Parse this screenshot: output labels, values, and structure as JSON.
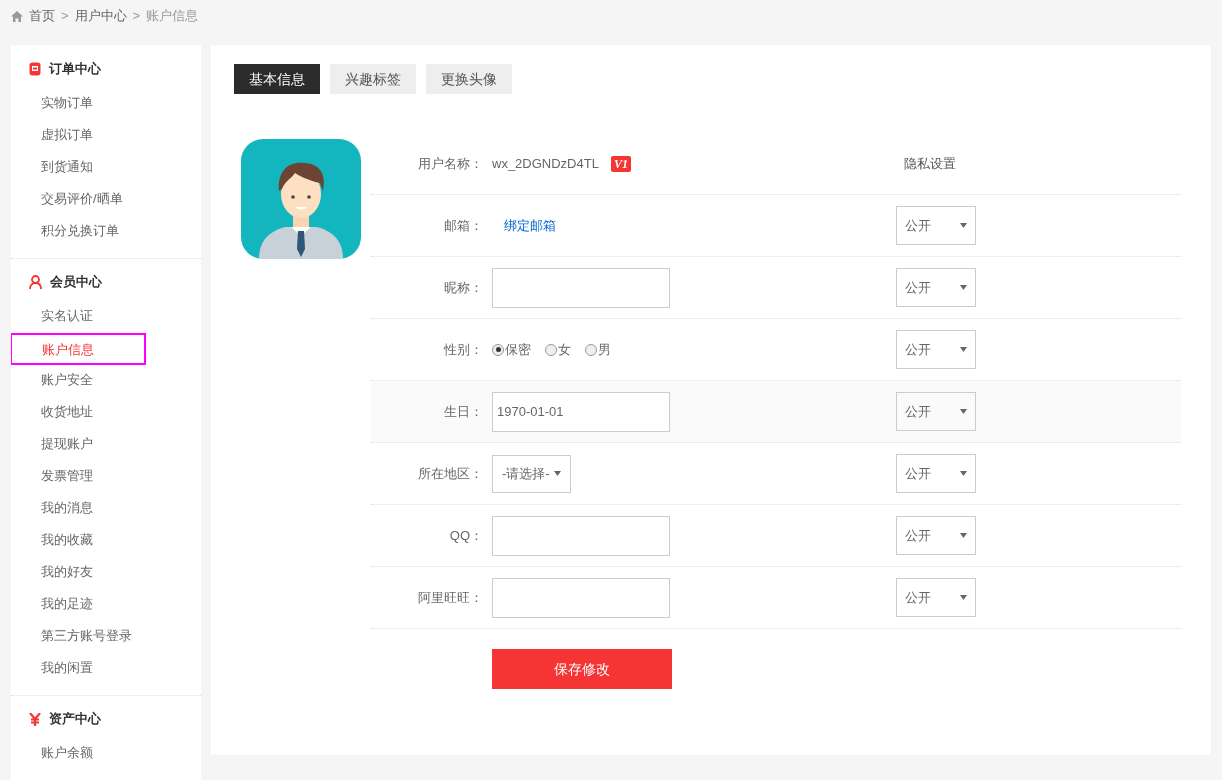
{
  "breadcrumb": {
    "separator": ">",
    "items": [
      "首页",
      "用户中心",
      "账户信息"
    ]
  },
  "sidebar": {
    "groups": [
      {
        "kind": "order",
        "title": "订单中心",
        "items": [
          {
            "label": "实物订单",
            "selected": false
          },
          {
            "label": "虚拟订单",
            "selected": false
          },
          {
            "label": "到货通知",
            "selected": false
          },
          {
            "label": "交易评价/晒单",
            "selected": false
          },
          {
            "label": "积分兑换订单",
            "selected": false
          }
        ]
      },
      {
        "kind": "member",
        "title": "会员中心",
        "items": [
          {
            "label": "实名认证",
            "selected": false
          },
          {
            "label": "账户信息",
            "selected": true
          },
          {
            "label": "账户安全",
            "selected": false
          },
          {
            "label": "收货地址",
            "selected": false
          },
          {
            "label": "提现账户",
            "selected": false
          },
          {
            "label": "发票管理",
            "selected": false
          },
          {
            "label": "我的消息",
            "selected": false
          },
          {
            "label": "我的收藏",
            "selected": false
          },
          {
            "label": "我的好友",
            "selected": false
          },
          {
            "label": "我的足迹",
            "selected": false
          },
          {
            "label": "第三方账号登录",
            "selected": false
          },
          {
            "label": "我的闲置",
            "selected": false
          }
        ]
      },
      {
        "kind": "asset",
        "title": "资产中心",
        "items": [
          {
            "label": "账户余额",
            "selected": false
          }
        ]
      }
    ]
  },
  "tabs": [
    {
      "label": "基本信息",
      "selected": true
    },
    {
      "label": "兴趣标签",
      "selected": false
    },
    {
      "label": "更换头像",
      "selected": false
    }
  ],
  "form": {
    "privacy_header": "隐私设置",
    "rows": [
      {
        "kind": "username",
        "label": "用户名称：",
        "value": "wx_2DGNDzD4TL",
        "badge": "V1"
      },
      {
        "kind": "link",
        "label": "邮箱：",
        "value": "绑定邮箱",
        "privacy": "公开"
      },
      {
        "kind": "text",
        "label": "昵称：",
        "privacy": "公开"
      },
      {
        "kind": "radio",
        "label": "性别：",
        "options": [
          {
            "label": "保密",
            "selected": true
          },
          {
            "label": "女",
            "selected": false
          },
          {
            "label": "男",
            "selected": false
          }
        ],
        "privacy": "公开"
      },
      {
        "kind": "date",
        "label": "生日：",
        "value": "1970-01-01",
        "privacy": "公开",
        "highlighted": true
      },
      {
        "kind": "select",
        "label": "所在地区：",
        "value": "-请选择-",
        "privacy": "公开"
      },
      {
        "kind": "text",
        "label": "QQ：",
        "privacy": "公开"
      },
      {
        "kind": "text",
        "label": "阿里旺旺：",
        "privacy": "公开"
      }
    ],
    "save_button": "保存修改"
  }
}
